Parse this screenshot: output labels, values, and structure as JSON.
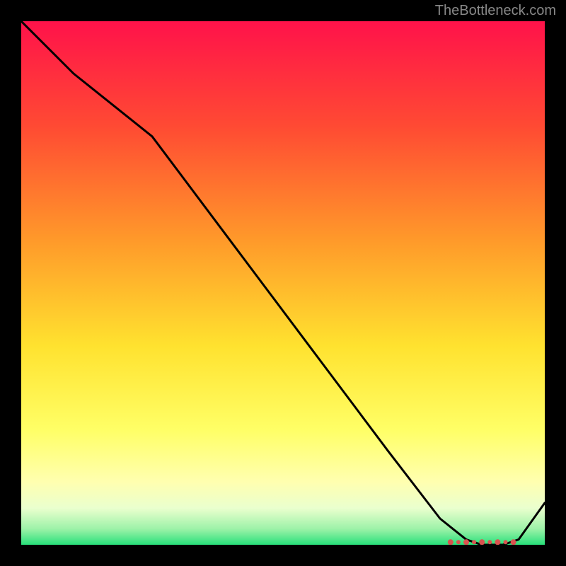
{
  "watermark": "TheBottleneck.com",
  "chart_data": {
    "type": "line",
    "title": "",
    "xlabel": "",
    "ylabel": "",
    "xlim": [
      0,
      100
    ],
    "ylim": [
      0,
      100
    ],
    "x": [
      0,
      10,
      25,
      40,
      55,
      70,
      80,
      85,
      88,
      90,
      92,
      95,
      100
    ],
    "values": [
      100,
      90,
      78,
      58,
      38,
      18,
      5,
      1,
      0,
      0,
      0,
      1,
      8
    ],
    "optimal_zone": {
      "x_start": 82,
      "x_end": 94
    },
    "gradient_stops": [
      {
        "pos": 0.0,
        "color": "#ff124a"
      },
      {
        "pos": 0.2,
        "color": "#ff4a33"
      },
      {
        "pos": 0.42,
        "color": "#ff9a2a"
      },
      {
        "pos": 0.62,
        "color": "#ffe22f"
      },
      {
        "pos": 0.78,
        "color": "#ffff66"
      },
      {
        "pos": 0.88,
        "color": "#ffffb0"
      },
      {
        "pos": 0.93,
        "color": "#eaffce"
      },
      {
        "pos": 0.97,
        "color": "#9cf2a8"
      },
      {
        "pos": 1.0,
        "color": "#28e07a"
      }
    ]
  }
}
